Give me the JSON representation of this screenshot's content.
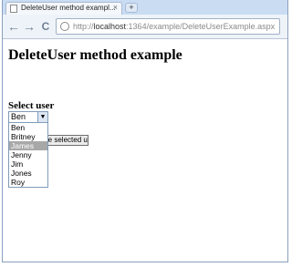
{
  "browser": {
    "tab_title": "DeleteUser method exampl...",
    "tab_close": "×",
    "new_tab": "+",
    "back": "←",
    "forward": "→",
    "reload": "C",
    "url_prefix": "http://",
    "url_host": "localhost",
    "url_rest": ":1364/example/DeleteUserExample.aspx"
  },
  "page": {
    "heading": "DeleteUser method example",
    "select_label": "Select user",
    "selected_value": "Ben",
    "dropdown_arrow": "▼",
    "button_label": "Delete selected user",
    "options": [
      "Ben",
      "Britney",
      "James",
      "Jenny",
      "Jim",
      "Jones",
      "Roy"
    ],
    "highlighted_option": "James"
  }
}
